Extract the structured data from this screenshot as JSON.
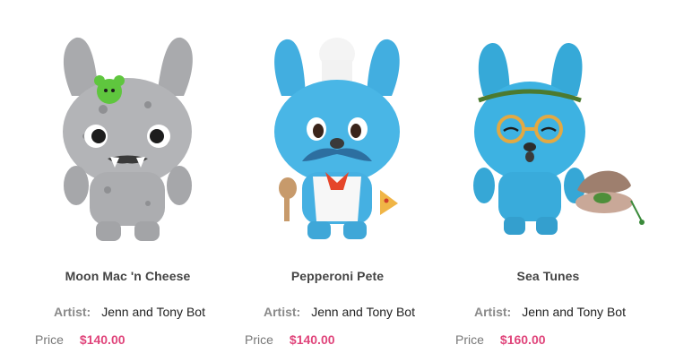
{
  "colors": {
    "price": "#e0457b",
    "title": "#444444",
    "label": "#8a8a8a"
  },
  "products": [
    {
      "name": "Moon Mac 'n Cheese",
      "artist_label": "Artist:",
      "artist": "Jenn and Tony Bot",
      "price_label": "Price",
      "price": "$140.00",
      "image_icon": "gray-vinyl-figure-image"
    },
    {
      "name": "Pepperoni Pete",
      "artist_label": "Artist:",
      "artist": "Jenn and Tony Bot",
      "price_label": "Price",
      "price": "$140.00",
      "image_icon": "blue-chef-vinyl-figure-image"
    },
    {
      "name": "Sea Tunes",
      "artist_label": "Artist:",
      "artist": "Jenn and Tony Bot",
      "price_label": "Price",
      "price": "$160.00",
      "image_icon": "blue-glasses-vinyl-figure-image"
    }
  ]
}
